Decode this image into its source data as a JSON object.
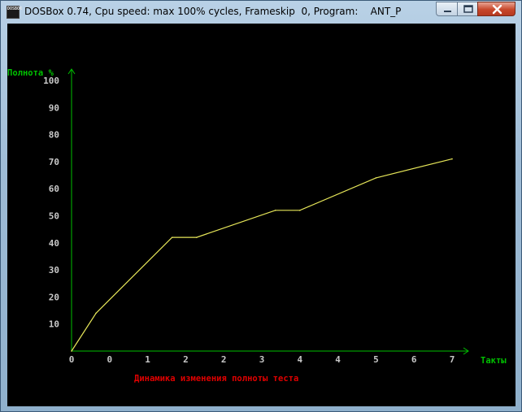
{
  "window": {
    "title": "DOSBox 0.74, Cpu speed: max 100% cycles, Frameskip  0, Program:    ANT_P",
    "icon_label": "DOSBOX",
    "controls": [
      "minimize-icon",
      "maximize-icon",
      "close-icon"
    ]
  },
  "colors": {
    "axis": "#00c000",
    "axis_label": "#00c000",
    "tick_label": "#c8c8c8",
    "line": "#e6e659",
    "caption": "#e00000",
    "screen": "#000000"
  },
  "chart_data": {
    "type": "line",
    "ylabel": "Полнота %",
    "xlabel": "Такты",
    "caption": "Динамика изменения полноты теста",
    "y_ticks": [
      "10",
      "20",
      "30",
      "40",
      "50",
      "60",
      "70",
      "80",
      "90",
      "100"
    ],
    "x_ticks": [
      "0",
      "0",
      "1",
      "2",
      "2",
      "3",
      "4",
      "4",
      "5",
      "6",
      "7"
    ],
    "x": [
      0,
      0.45,
      1.85,
      2.3,
      3.75,
      4.2,
      5.6,
      7.0
    ],
    "values": [
      0,
      14,
      42,
      42,
      52,
      52,
      64,
      71
    ],
    "xlim": [
      0,
      7
    ],
    "ylim": [
      0,
      100
    ],
    "grid": false
  }
}
